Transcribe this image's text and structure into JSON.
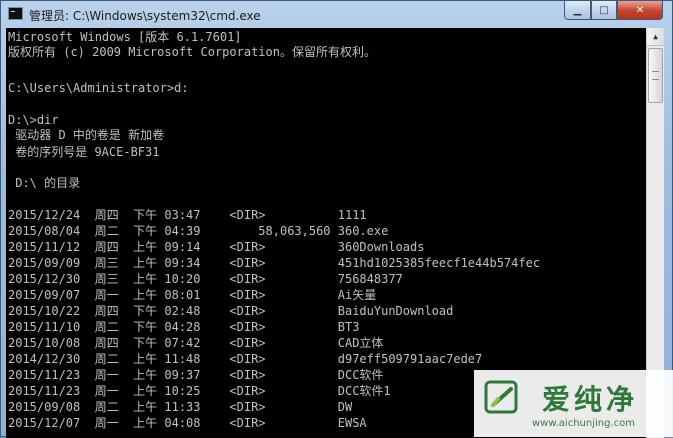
{
  "window": {
    "title": "管理员: C:\\Windows\\system32\\cmd.exe",
    "minimize_symbol": "▁",
    "maximize_symbol": "□",
    "close_symbol": "✕"
  },
  "console_lines": [
    "Microsoft Windows [版本 6.1.7601]",
    "版权所有 (c) 2009 Microsoft Corporation。保留所有权利。",
    "",
    "C:\\Users\\Administrator>d:",
    "",
    "D:\\>dir",
    " 驱动器 D 中的卷是 新加卷",
    " 卷的序列号是 9ACE-BF31",
    "",
    " D:\\ 的目录",
    "",
    "2015/12/24  周四  下午 03:47    <DIR>          1111",
    "2015/08/04  周二  下午 04:39        58,063,560 360.exe",
    "2015/11/12  周四  上午 09:14    <DIR>          360Downloads",
    "2015/09/09  周三  上午 09:34    <DIR>          451hd1025385feecf1e44b574fec",
    "2015/12/30  周三  上午 10:20    <DIR>          756848377",
    "2015/09/07  周一  上午 08:01    <DIR>          Ai矢量",
    "2015/10/22  周四  下午 02:48    <DIR>          BaiduYunDownload",
    "2015/11/10  周二  下午 04:28    <DIR>          BT3",
    "2015/10/08  周四  下午 07:42    <DIR>          CAD立体",
    "2014/12/30  周二  上午 11:48    <DIR>          d97eff509791aac7ede7",
    "2015/11/23  周一  上午 09:37    <DIR>          DCC软件",
    "2015/11/23  周一  上午 10:25    <DIR>          DCC软件1",
    "2015/09/08  周二  上午 11:33    <DIR>          DW",
    "2015/12/07  周一  上午 04:08    <DIR>          EWSA"
  ],
  "scrollbar": {
    "up_arrow": "▲"
  },
  "watermark": {
    "title": "爱纯净",
    "url": "www.aichunjing.com"
  }
}
